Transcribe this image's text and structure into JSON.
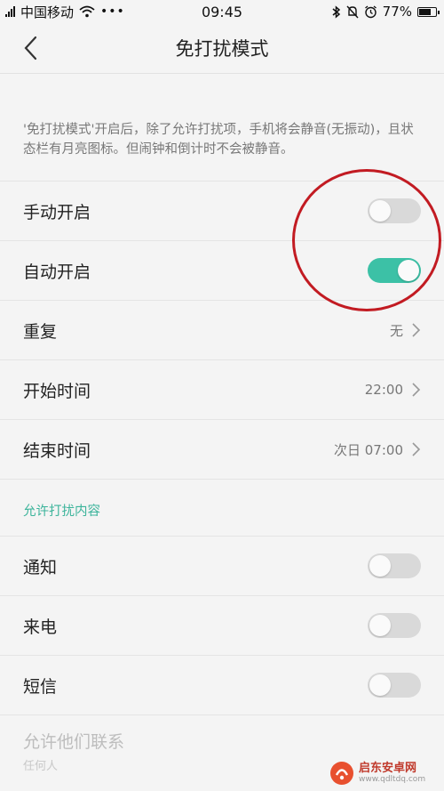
{
  "status_bar": {
    "carrier": "中国移动",
    "time": "09:45",
    "battery_text": "77%",
    "battery_level": 0.77,
    "icons": [
      "signal-icon",
      "wifi-icon",
      "more-dots-icon",
      "bluetooth-icon",
      "mute-bell-icon",
      "alarm-icon",
      "battery-icon"
    ]
  },
  "nav": {
    "title": "免打扰模式",
    "back_icon": "chevron-left-icon"
  },
  "description": "'免打扰模式'开启后，除了允许打扰项，手机将会静音(无振动)，且状态栏有月亮图标。但闹钟和倒计时不会被静音。",
  "settings": {
    "manual_on": {
      "label": "手动开启",
      "enabled": false
    },
    "auto_on": {
      "label": "自动开启",
      "enabled": true
    },
    "repeat": {
      "label": "重复",
      "value": "无"
    },
    "start_time": {
      "label": "开始时间",
      "value": "22:00"
    },
    "end_time": {
      "label": "结束时间",
      "value": "次日 07:00"
    }
  },
  "allowed_section": {
    "header": "允许打扰内容",
    "notifications": {
      "label": "通知",
      "enabled": false
    },
    "calls": {
      "label": "来电",
      "enabled": false
    },
    "sms": {
      "label": "短信",
      "enabled": false
    },
    "allow_contacts": {
      "label": "允许他们联系",
      "sub": "任何人"
    }
  },
  "colors": {
    "accent": "#3cc1a6",
    "section_header": "#3cb49b",
    "annotation": "#c21b22"
  },
  "watermark": {
    "text": "启东安卓网",
    "url": "www.qdltdq.com"
  }
}
